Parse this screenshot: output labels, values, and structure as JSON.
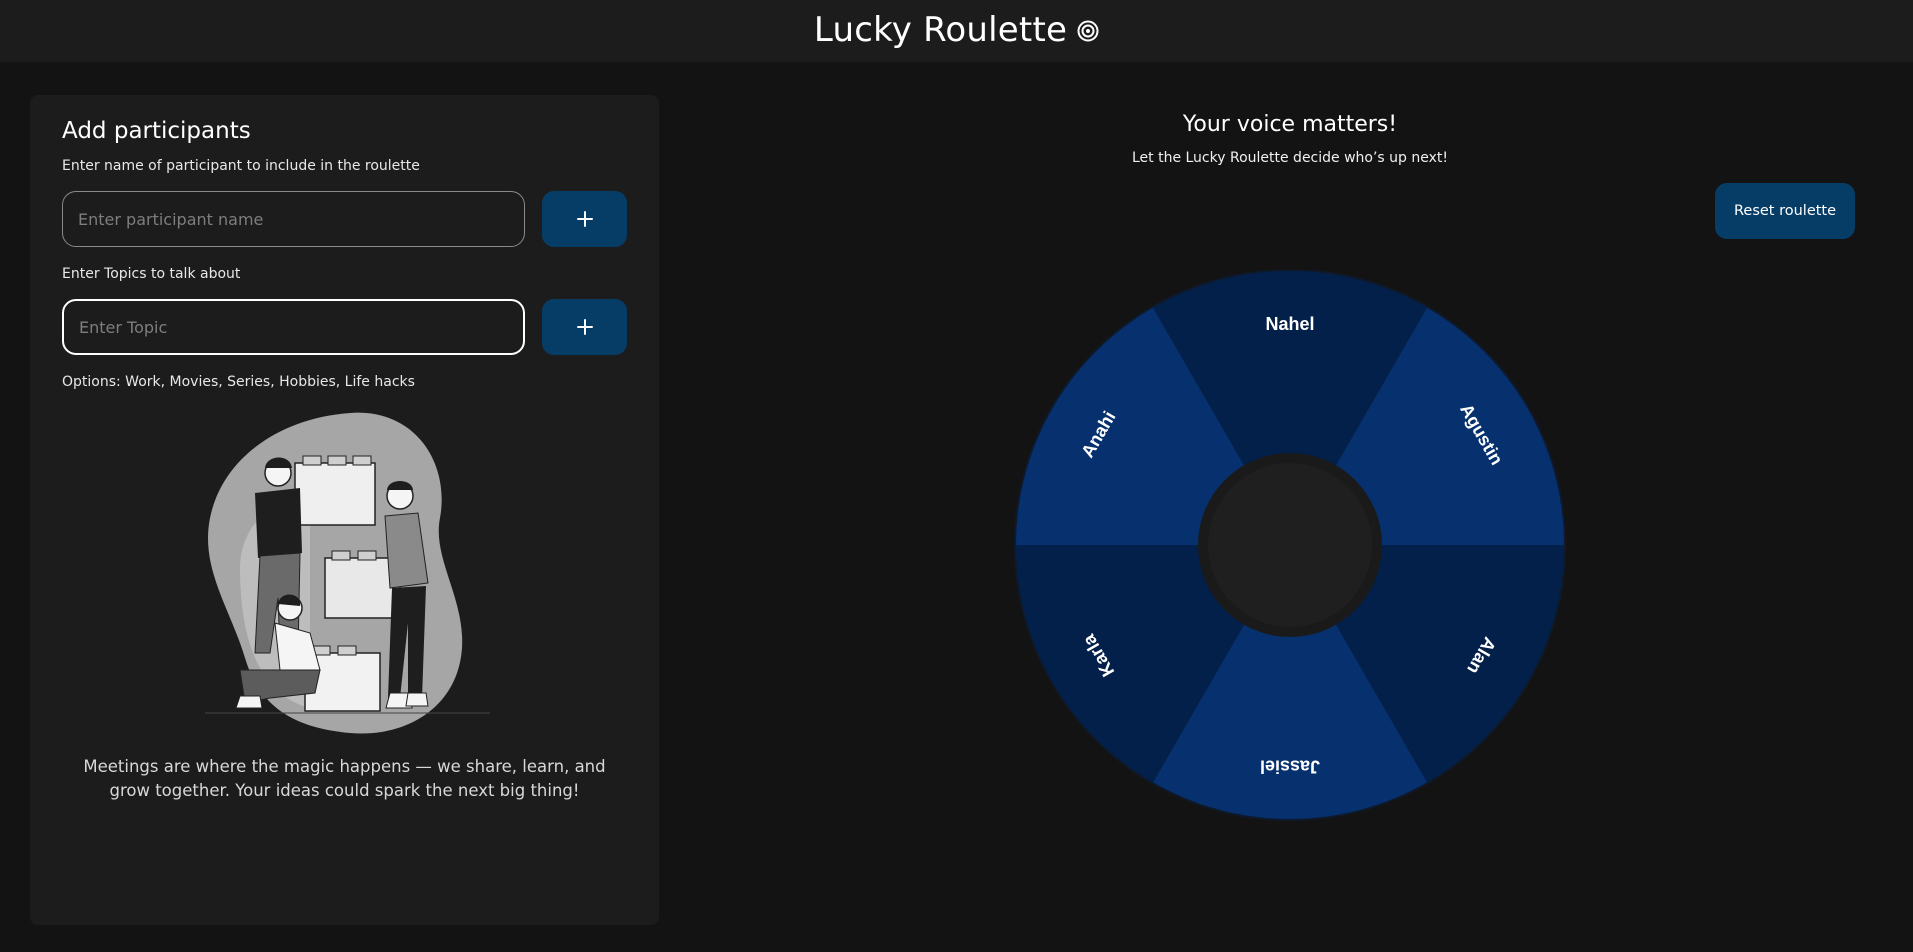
{
  "app": {
    "title": "Lucky Roulette",
    "title_icon": "target-icon"
  },
  "participants_panel": {
    "title": "Add participants",
    "participant_label": "Enter name of participant to include in the roulette",
    "participant_placeholder": "Enter participant name",
    "participant_value": "",
    "topic_label": "Enter Topics to talk about",
    "topic_placeholder": "Enter Topic",
    "topic_value": "",
    "add_button_icon": "plus-icon",
    "options_text": "Options: Work, Movies, Series, Hobbies, Life hacks",
    "illustration": "people-stacking-boxes-illustration",
    "quote": "Meetings are where the magic happens — we share, learn, and grow together. Your ideas could spark the next big thing!"
  },
  "main": {
    "heading": "Your voice matters!",
    "subheading": "Let the Lucky Roulette decide who’s up next!",
    "reset_label": "Reset roulette"
  },
  "wheel": {
    "participants": [
      "Nahel",
      "Agustin",
      "Alan",
      "Jassiel",
      "Karla",
      "Anahi"
    ],
    "colors": {
      "dark": "#03204a",
      "light": "#06306e",
      "rim": "#0e1a2c",
      "hub": "#1f1f1f"
    }
  },
  "colors": {
    "background": "#131313",
    "panel": "#1c1c1c",
    "button": "#063d67"
  }
}
